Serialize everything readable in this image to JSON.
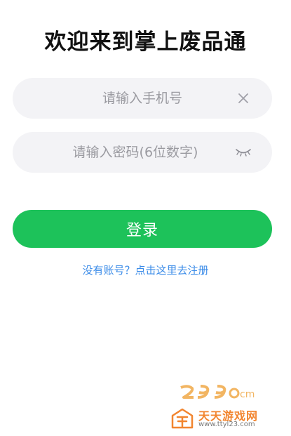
{
  "page": {
    "title": "欢迎来到掌上废品通"
  },
  "form": {
    "phone_placeholder": "请输入手机号",
    "password_placeholder": "请输入密码(6位数字)",
    "login_label": "登录",
    "register_link": "没有账号？点击这里去注册"
  },
  "icons": {
    "clear": "close-icon",
    "toggle_password": "eye-closed-icon"
  },
  "watermarks": {
    "site_top": "2 9 9 c m",
    "site_name": "天天游戏网",
    "site_url": "www.ttyl23.com"
  },
  "colors": {
    "accent": "#1dc25a",
    "link": "#3a8be8",
    "field_bg": "#f3f3f6",
    "watermark": "#f2852f"
  }
}
